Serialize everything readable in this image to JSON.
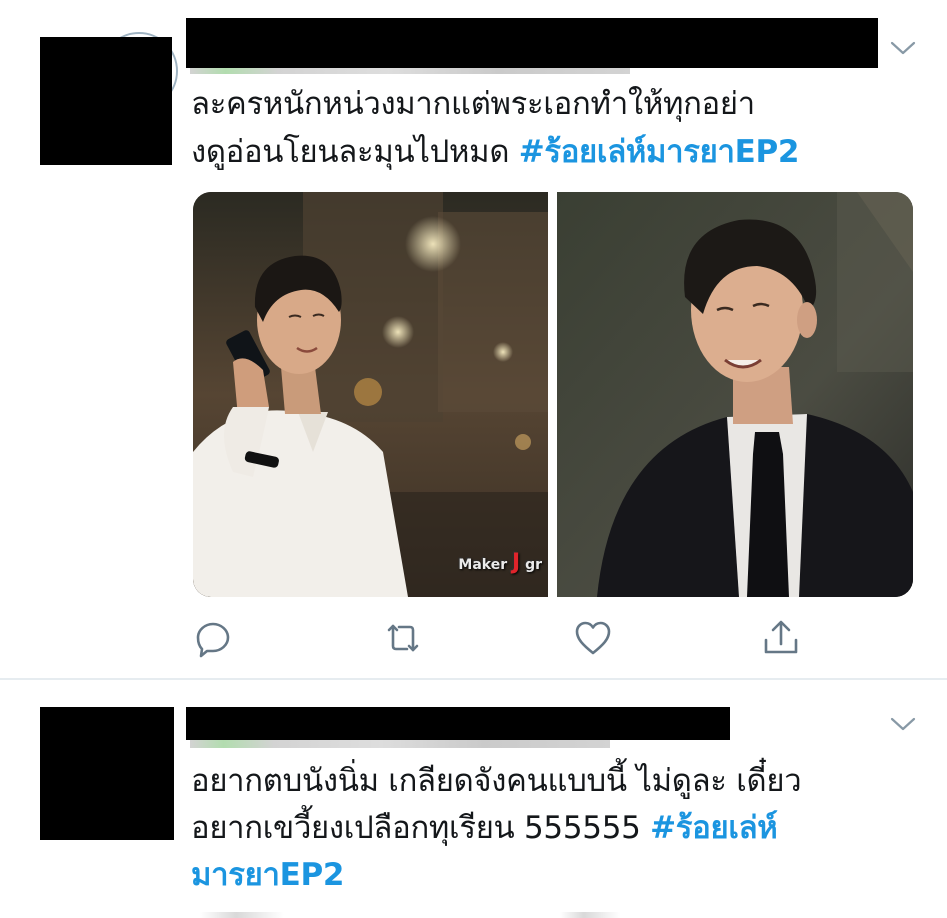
{
  "tweets": [
    {
      "text_lines": [
        "ละครหนักหน่วงมากแต่พระเอกทำให้ทุกอย่า",
        "งดูอ่อนโยนละมุนไปหมด "
      ],
      "hashtag": "#ร้อยเล่ห์มารยาEP2",
      "media": {
        "watermark_prefix": "Maker",
        "watermark_letter": "J",
        "watermark_suffix": "gr"
      },
      "actions": [
        "reply-icon",
        "retweet-icon",
        "like-icon",
        "share-icon"
      ]
    },
    {
      "text_lines": [
        "อยากตบนังนิ่ม เกลียดจังคนแบบนี้ ไม่ดูละ เดี๋ยว",
        "อยากเขวี้ยงเปลือกทุเรียน 555555 "
      ],
      "hashtag_line2": "#ร้อยเล่ห์",
      "hashtag_line3": "มารยาEP2"
    }
  ],
  "colors": {
    "hashtag": "#1b95e0",
    "icon": "#657786",
    "divider": "#e6ecf0"
  }
}
